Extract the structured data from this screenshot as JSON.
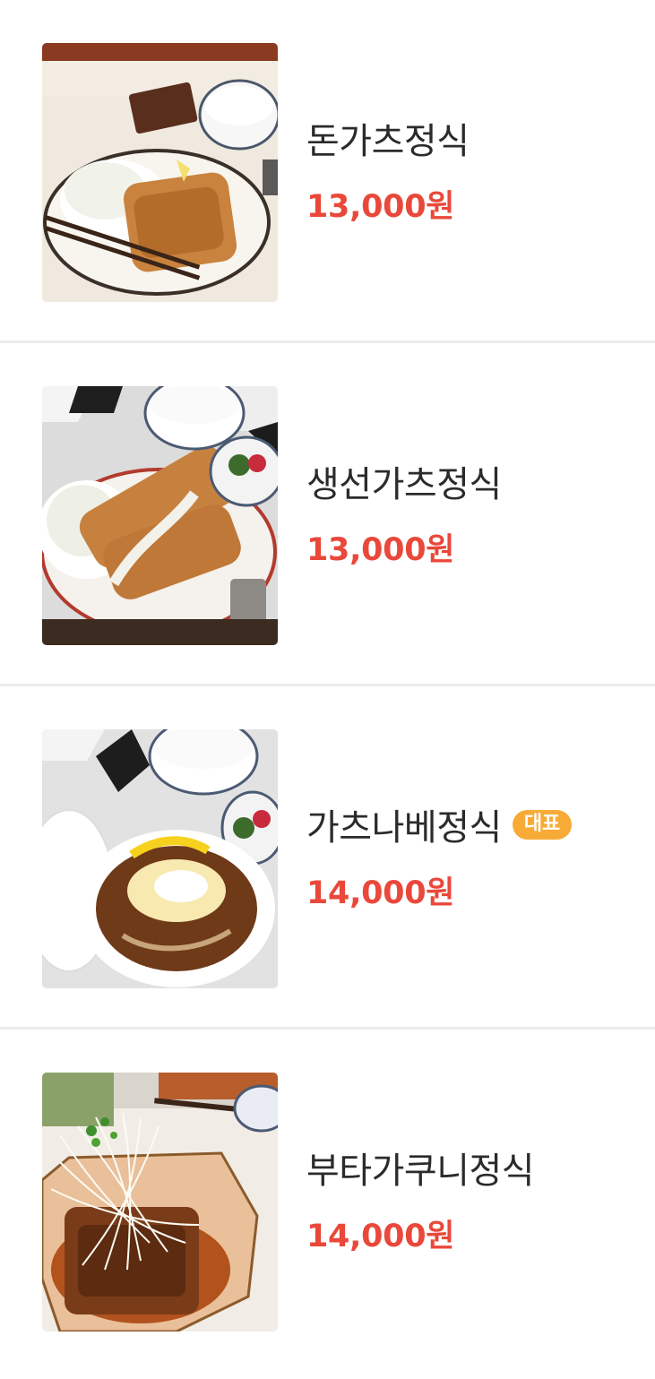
{
  "menu": {
    "items": [
      {
        "name": "돈가츠정식",
        "price": "13,000원",
        "badge": "",
        "image": "tonkatsu-set-photo"
      },
      {
        "name": "생선가츠정식",
        "price": "13,000원",
        "badge": "",
        "image": "fish-katsu-set-photo"
      },
      {
        "name": "가츠나베정식",
        "price": "14,000원",
        "badge": "대표",
        "image": "katsu-nabe-set-photo"
      },
      {
        "name": "부타가쿠니정식",
        "price": "14,000원",
        "badge": "",
        "image": "buta-kakuni-set-photo"
      }
    ]
  }
}
